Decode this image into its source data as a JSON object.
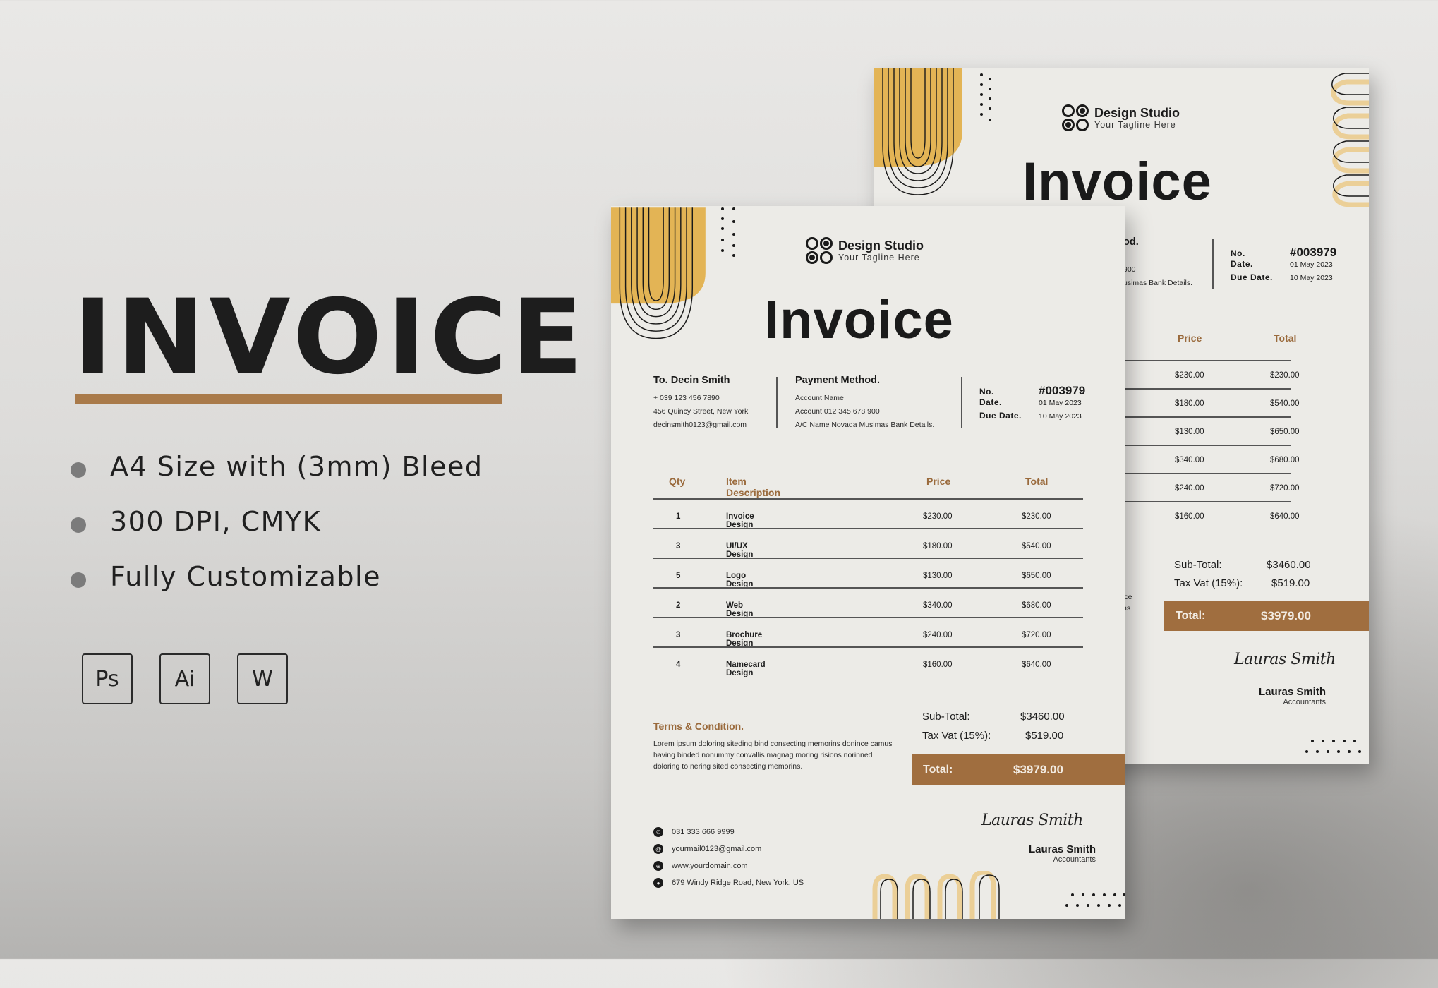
{
  "promo": {
    "title": "INVOICE",
    "features": [
      "A4 Size with (3mm) Bleed",
      "300 DPI, CMYK",
      "Fully Customizable"
    ],
    "apps": [
      "Ps",
      "Ai",
      "W"
    ]
  },
  "colors": {
    "accent_brown": "#a06e3f",
    "accent_yellow": "#e3b455",
    "paper": "#ecebe7",
    "text": "#1a1a1a"
  },
  "invoice": {
    "brand_name": "Design Studio",
    "brand_tagline": "Your Tagline Here",
    "title": "Invoice",
    "bill_to": {
      "heading": "To. Decin Smith",
      "lines": [
        "+ 039  123  456 7890",
        "456  Quincy Street, New York",
        "decinsmith0123@gmail.com"
      ]
    },
    "payment": {
      "heading": "Payment Method.",
      "lines": [
        "Account Name",
        "Account 012 345 678 900",
        "A/C Name Novada Musimas Bank Details."
      ]
    },
    "meta": {
      "no_label": "No.",
      "no_value": "#003979",
      "date_label": "Date.",
      "date_value": "01 May 2023",
      "due_label": "Due Date.",
      "due_value": "10 May 2023"
    },
    "table": {
      "headers": [
        "Qty",
        "Item Description",
        "Price",
        "Total"
      ],
      "rows": [
        {
          "qty": "1",
          "item": "Invoice Design",
          "price": "$230.00",
          "total": "$230.00"
        },
        {
          "qty": "3",
          "item": "UI/UX Design",
          "price": "$180.00",
          "total": "$540.00"
        },
        {
          "qty": "5",
          "item": "Logo Design",
          "price": "$130.00",
          "total": "$650.00"
        },
        {
          "qty": "2",
          "item": "Web Design",
          "price": "$340.00",
          "total": "$680.00"
        },
        {
          "qty": "3",
          "item": "Brochure Design",
          "price": "$240.00",
          "total": "$720.00"
        },
        {
          "qty": "4",
          "item": "Namecard Design",
          "price": "$160.00",
          "total": "$640.00"
        }
      ]
    },
    "terms": {
      "heading": "Terms & Condition.",
      "body": "Lorem ipsum doloring siteding bind consecting memorins donince camus having binded nonummy convallis magnag moring risions norinned doloring to nering sited consecting memorins."
    },
    "summary": {
      "subtotal_label": "Sub-Total:",
      "subtotal_value": "$3460.00",
      "tax_label": "Tax Vat (15%):",
      "tax_value": "$519.00",
      "total_label": "Total:",
      "total_value": "$3979.00"
    },
    "contact": [
      {
        "icon": "phone-icon",
        "glyph": "✆",
        "text": "031 333 666 9999"
      },
      {
        "icon": "email-icon",
        "glyph": "@",
        "text": "yourmail0123@gmail.com"
      },
      {
        "icon": "globe-icon",
        "glyph": "⊕",
        "text": "www.yourdomain.com"
      },
      {
        "icon": "location-pin-icon",
        "glyph": "●",
        "text": "679 Windy Ridge Road, New York, US"
      }
    ],
    "signature_script": "Lauras Smith",
    "signer_name": "Lauras Smith",
    "signer_role": "Accountants"
  },
  "back_invoice": {
    "payment_heading_fragment": "od.",
    "payment_fragments": [
      "900",
      "usimas Bank Details."
    ],
    "terms_fragments": [
      "ice",
      "ns"
    ]
  }
}
